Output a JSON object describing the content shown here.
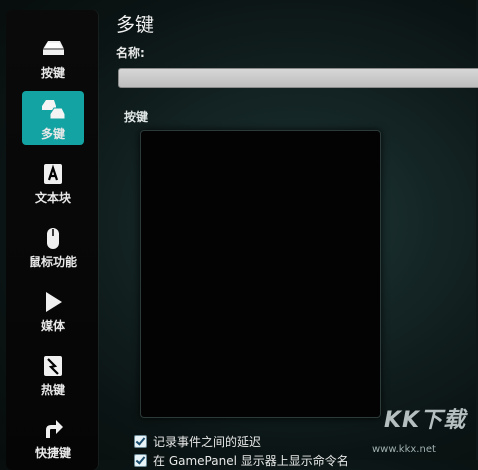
{
  "sidebar": {
    "items": [
      {
        "label": "按键",
        "icon": "key-icon",
        "active": false
      },
      {
        "label": "多键",
        "icon": "multi-key-icon",
        "active": true
      },
      {
        "label": "文本块",
        "icon": "text-block-icon",
        "active": false
      },
      {
        "label": "鼠标功能",
        "icon": "mouse-icon",
        "active": false
      },
      {
        "label": "媒体",
        "icon": "play-icon",
        "active": false
      },
      {
        "label": "热键",
        "icon": "hotkey-icon",
        "active": false
      },
      {
        "label": "快捷键",
        "icon": "shortcut-arrow-icon",
        "active": false
      }
    ]
  },
  "main": {
    "title": "多键",
    "name_label": "名称:",
    "name_value": "",
    "keys_label": "按键",
    "checkboxes": [
      {
        "label": "记录事件之间的延迟",
        "checked": true
      },
      {
        "label": "在 GamePanel 显示器上显示命令名",
        "checked": true
      }
    ]
  },
  "watermark": {
    "logo": "KK下载",
    "url": "www.kkx.net"
  },
  "colors": {
    "accent": "#13a3a3",
    "sidebar_bg": "#050505"
  }
}
